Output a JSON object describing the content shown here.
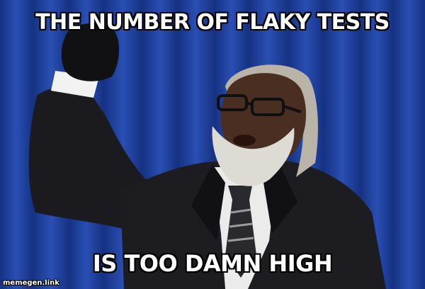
{
  "meme": {
    "top_text": "THE NUMBER OF FLAKY TESTS",
    "bottom_text": "IS TOO DAMN HIGH",
    "watermark": "memegen.link"
  },
  "photo": {
    "background": "blue stage curtain",
    "subject": "man in black suit with raised gloved fist, glasses, white beard"
  },
  "colors": {
    "curtain": "#1f3f99",
    "caption_fill": "#ffffff",
    "caption_outline": "#000000"
  }
}
